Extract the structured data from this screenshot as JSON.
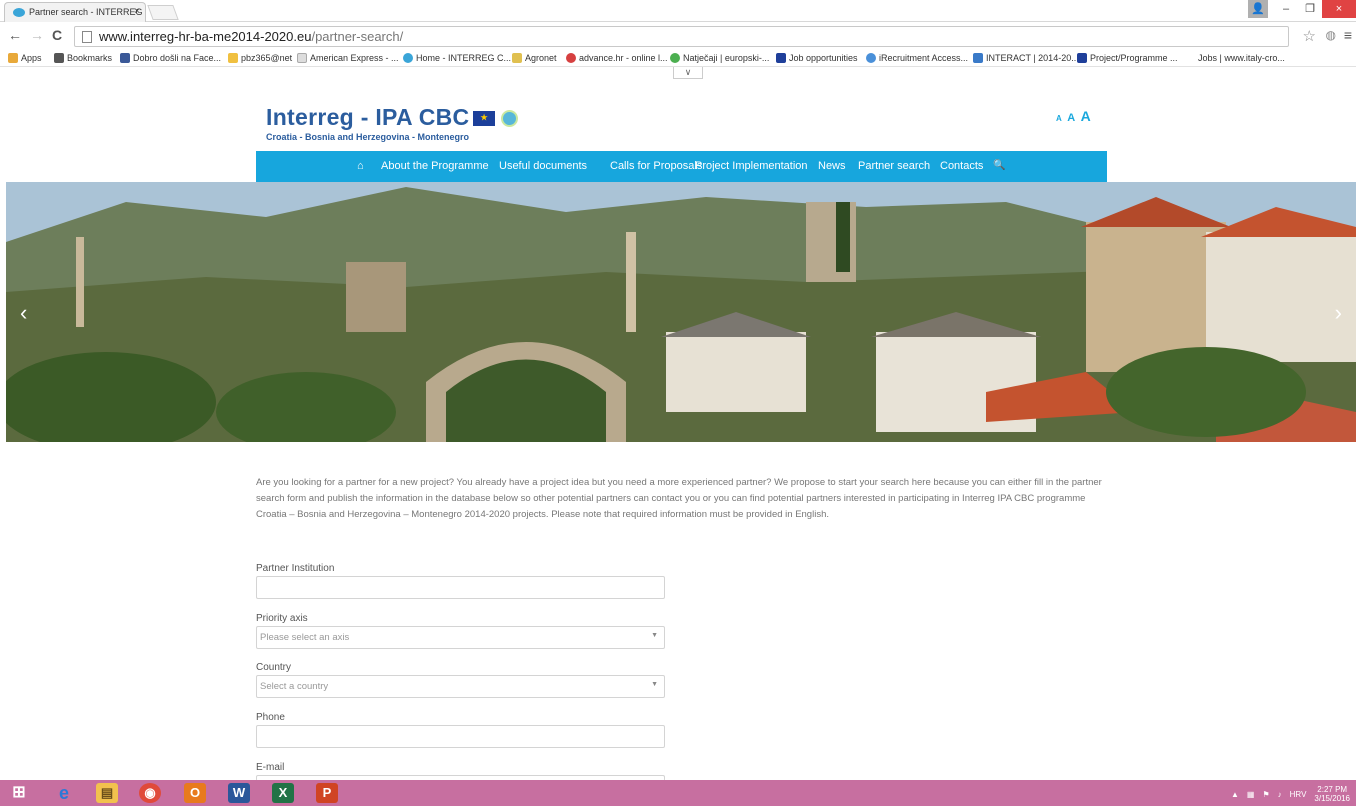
{
  "browser": {
    "tab_title": "Partner search - INTERREG",
    "tab_close": "×",
    "url_host": "www.interreg-hr-ba-me2014-2020.eu",
    "url_path": "/partner-search/",
    "window_buttons": {
      "minimize": "–",
      "restore": "❐",
      "close": "×",
      "user": "👤"
    },
    "nav_icons": {
      "back": "←",
      "forward": "→",
      "reload": "C"
    },
    "star": "☆",
    "menu": "≡",
    "bookmarks": [
      {
        "label": "Apps",
        "color": "#e8a93a"
      },
      {
        "label": "Bookmarks",
        "color": "#555555"
      },
      {
        "label": "Dobro došli na Face...",
        "color": "#3b5998"
      },
      {
        "label": "pbz365@net",
        "color": "#f0c040"
      },
      {
        "label": "American Express - ...",
        "color": "#bbbbbb"
      },
      {
        "label": "Home - INTERREG C...",
        "color": "#3aa5d8"
      },
      {
        "label": "Agronet",
        "color": "#e0c050"
      },
      {
        "label": "advance.hr - online l...",
        "color": "#d64040"
      },
      {
        "label": "Natječaji | europski-...",
        "color": "#4caf50"
      },
      {
        "label": "Job opportunities",
        "color": "#1f3f9a"
      },
      {
        "label": "iRecruitment Access...",
        "color": "#4a90d9"
      },
      {
        "label": "INTERACT | 2014-20...",
        "color": "#3a7ac8"
      },
      {
        "label": "Project/Programme ...",
        "color": "#1f3f9a"
      },
      {
        "label": "Jobs | www.italy-cro...",
        "color": "#ffffff"
      }
    ],
    "dropdown_chevron": "∨"
  },
  "site": {
    "logo_title": "Interreg - IPA CBC",
    "logo_subtitle": "Croatia - Bosnia and Herzegovina - Montenegro",
    "font_sizes": [
      "A",
      "A",
      "A"
    ],
    "nav_home": "⌂",
    "nav_items": [
      "About the Programme",
      "Useful documents",
      "Calls for Proposals",
      "Project Implementation",
      "News",
      "Partner search",
      "Contacts"
    ],
    "nav_search": "🔍",
    "slider_prev": "‹",
    "slider_next": "›",
    "intro": "Are you looking for a partner for a new project? You already have a project idea but you need a more experienced partner? We propose to start your search here because you can either fill in the partner search form and publish the information in the database below so other potential partners can contact you or you can find potential partners interested in participating in Interreg IPA CBC programme Croatia – Bosnia and Herzegovina – Montenegro 2014-2020 projects.  Please note that required information must be provided in English."
  },
  "form": {
    "partner_institution_label": "Partner Institution",
    "partner_institution_value": "",
    "priority_axis_label": "Priority axis",
    "priority_axis_placeholder": "Please select an axis",
    "country_label": "Country",
    "country_placeholder": "Select a country",
    "phone_label": "Phone",
    "phone_value": "",
    "email_label": "E-mail",
    "select_caret": "▼"
  },
  "taskbar": {
    "apps": [
      {
        "name": "windows-start",
        "glyph": "⊞",
        "color": "#c76fa0"
      },
      {
        "name": "internet-explorer",
        "glyph": "e",
        "color": "#2b79d6"
      },
      {
        "name": "file-explorer",
        "glyph": "▤",
        "color": "#f2c14e"
      },
      {
        "name": "chrome",
        "glyph": "◉",
        "color": "#e04a3a"
      },
      {
        "name": "outlook",
        "glyph": "O",
        "color": "#e87a1e"
      },
      {
        "name": "word",
        "glyph": "W",
        "color": "#2b579a"
      },
      {
        "name": "excel",
        "glyph": "X",
        "color": "#217346"
      },
      {
        "name": "powerpoint",
        "glyph": "P",
        "color": "#d04423"
      }
    ],
    "language": "HRV",
    "time": "2:27 PM",
    "date": "3/15/2016"
  }
}
